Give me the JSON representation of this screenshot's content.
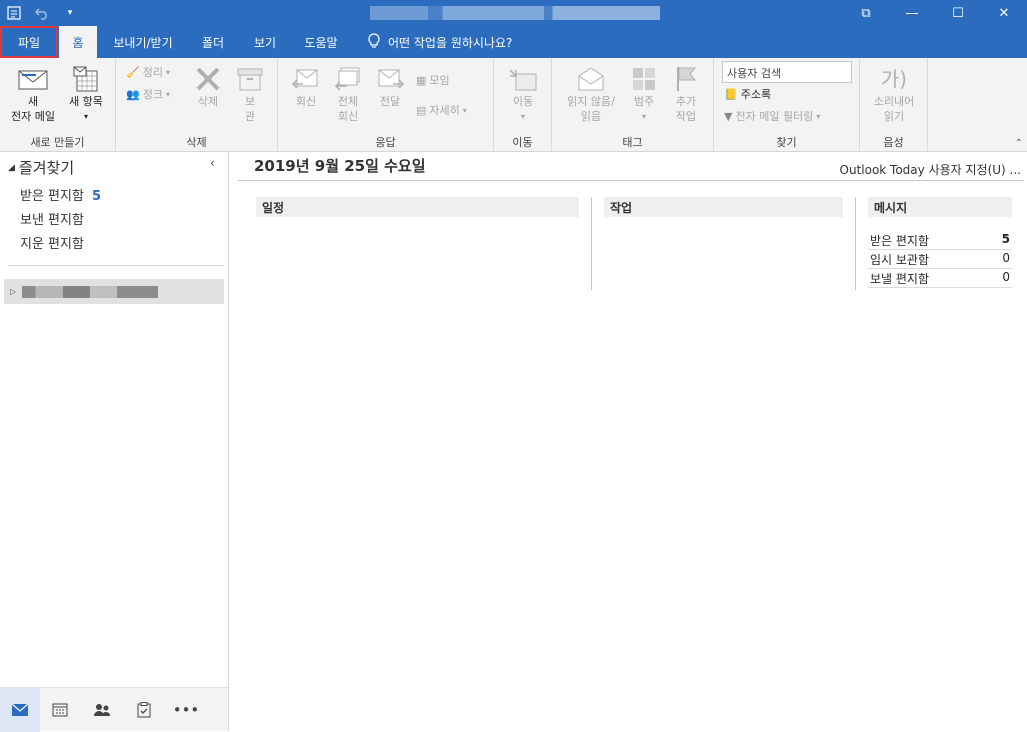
{
  "titlebar": {
    "restore_label": "⧉",
    "minimize_label": "—",
    "maximize_label": "☐",
    "close_label": "✕"
  },
  "tabs": [
    "파일",
    "홈",
    "보내기/받기",
    "폴더",
    "보기",
    "도움말"
  ],
  "tell_me": "어떤 작업을 원하시나요?",
  "ribbon": {
    "new": {
      "new_mail": [
        "새",
        "전자 메일"
      ],
      "new_items": "새 항목",
      "label": "새로 만들기"
    },
    "delete": {
      "clean_up": "정리",
      "junk": "정크",
      "delete": "삭제",
      "archive": [
        "보",
        "관"
      ],
      "label": "삭제"
    },
    "respond": {
      "reply": "회신",
      "reply_all": [
        "전체",
        "회신"
      ],
      "forward": "전달",
      "meeting": "모임",
      "more": "자세히",
      "label": "응답"
    },
    "move": {
      "move": "이동",
      "label": "이동"
    },
    "tags": {
      "unread_read": [
        "읽지 않음/",
        "읽음"
      ],
      "categorize": "범주",
      "follow_up": [
        "추가",
        "작업"
      ],
      "label": "태그"
    },
    "find": {
      "search_people_placeholder": "사용자 검색",
      "address_book": "주소록",
      "filter_email": "전자 메일 필터링",
      "label": "찾기"
    },
    "speech": {
      "read_aloud": [
        "소리내어",
        "읽기"
      ],
      "label": "음성"
    }
  },
  "nav": {
    "favorites_header": "즐겨찾기",
    "favorites": [
      {
        "label": "받은 편지함",
        "count": "5"
      },
      {
        "label": "보낸 편지함",
        "count": ""
      },
      {
        "label": "지운 편지함",
        "count": ""
      }
    ]
  },
  "main": {
    "date": "2019년 9월 25일 수요일",
    "customize": "Outlook Today 사용자 지정(U) ...",
    "calendar_header": "일정",
    "tasks_header": "작업",
    "messages_header": "메시지",
    "messages": [
      {
        "label": "받은 편지함",
        "value": "5"
      },
      {
        "label": "임시 보관함",
        "value": "0"
      },
      {
        "label": "보낼 편지함",
        "value": "0"
      }
    ]
  },
  "colors": {
    "brand": "#2b6cbf",
    "file_tab_border": "#e0383e"
  }
}
